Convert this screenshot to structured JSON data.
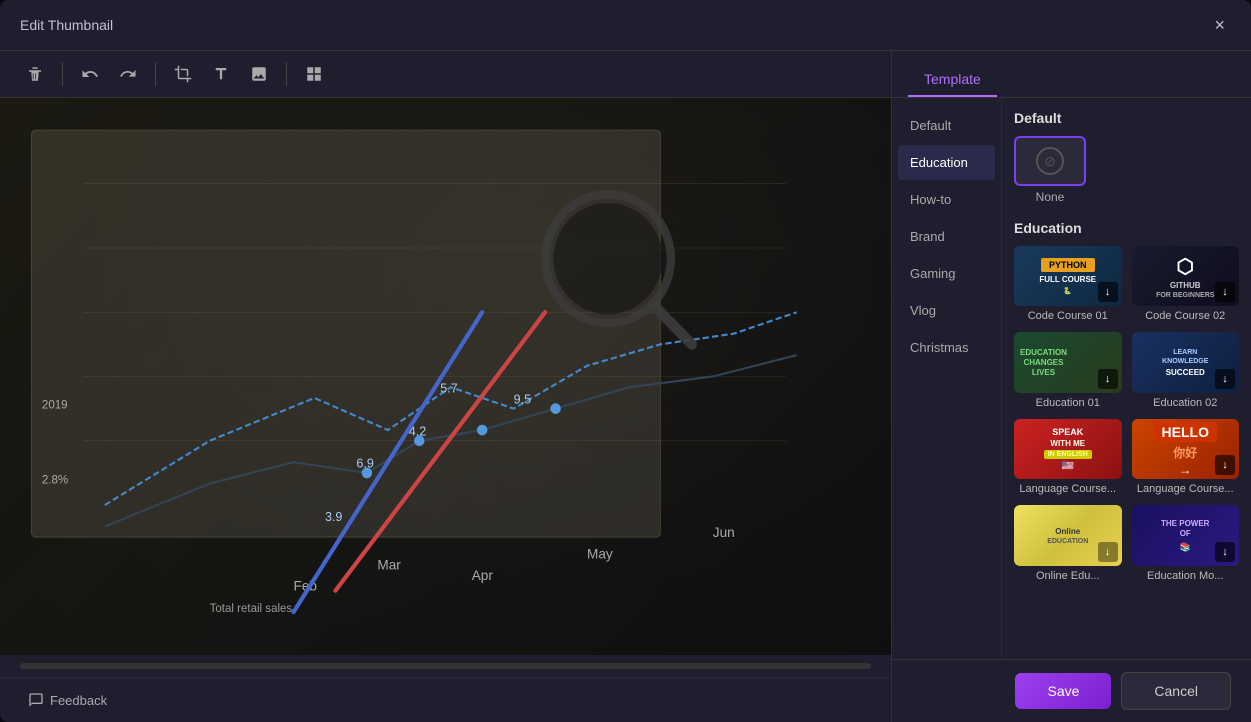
{
  "modal": {
    "title": "Edit Thumbnail",
    "close_label": "×"
  },
  "toolbar": {
    "delete_label": "🗑",
    "undo_label": "↩",
    "redo_label": "↪",
    "crop_label": "⊡",
    "text_label": "T",
    "image_label": "🖼",
    "layout_label": "⊞"
  },
  "panel": {
    "tab_label": "Template"
  },
  "categories": [
    {
      "id": "default",
      "label": "Default"
    },
    {
      "id": "education",
      "label": "Education",
      "active": true
    },
    {
      "id": "how-to",
      "label": "How-to"
    },
    {
      "id": "brand",
      "label": "Brand"
    },
    {
      "id": "gaming",
      "label": "Gaming"
    },
    {
      "id": "vlog",
      "label": "Vlog"
    },
    {
      "id": "christmas",
      "label": "Christmas"
    }
  ],
  "default_section": {
    "title": "Default",
    "none_label": "None"
  },
  "education_section": {
    "title": "Education",
    "templates": [
      {
        "id": "code-course-01",
        "label": "Code Course 01"
      },
      {
        "id": "code-course-02",
        "label": "Code Course 02"
      },
      {
        "id": "education-01",
        "label": "Education 01"
      },
      {
        "id": "education-02",
        "label": "Education 02"
      },
      {
        "id": "language-course-01",
        "label": "Language Course..."
      },
      {
        "id": "language-course-02",
        "label": "Language Course..."
      },
      {
        "id": "online-edu",
        "label": "Online Edu..."
      },
      {
        "id": "edu-more",
        "label": "Education Mo..."
      }
    ]
  },
  "footer": {
    "save_label": "Save",
    "cancel_label": "Cancel",
    "feedback_label": "Feedback"
  }
}
